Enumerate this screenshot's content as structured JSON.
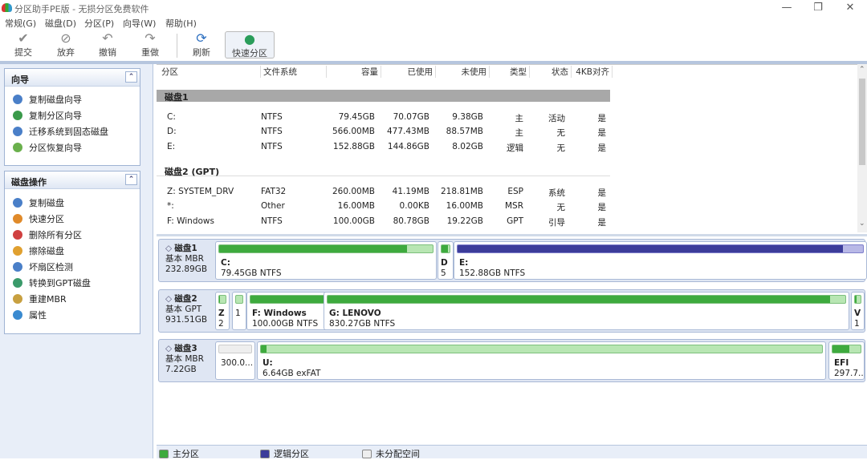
{
  "window": {
    "title": "分区助手PE版 - 无损分区免费软件"
  },
  "menu": [
    "常规(G)",
    "磁盘(D)",
    "分区(P)",
    "向导(W)",
    "帮助(H)"
  ],
  "toolbar": [
    {
      "label": "提交",
      "icon": "check-icon"
    },
    {
      "label": "放弃",
      "icon": "discard-icon"
    },
    {
      "label": "撤销",
      "icon": "undo-icon"
    },
    {
      "label": "重做",
      "icon": "redo-icon"
    },
    {
      "label": "刷新",
      "icon": "refresh-icon"
    },
    {
      "label": "快速分区",
      "icon": "quick-partition-icon"
    }
  ],
  "wizard": {
    "title": "向导",
    "items": [
      "复制磁盘向导",
      "复制分区向导",
      "迁移系统到固态磁盘",
      "分区恢复向导"
    ]
  },
  "ops": {
    "title": "磁盘操作",
    "items": [
      "复制磁盘",
      "快速分区",
      "删除所有分区",
      "擦除磁盘",
      "坏扇区检测",
      "转换到GPT磁盘",
      "重建MBR",
      "属性"
    ]
  },
  "table": {
    "headers": [
      "分区",
      "文件系统",
      "容量",
      "已使用",
      "未使用",
      "类型",
      "状态",
      "4KB对齐"
    ],
    "disks": [
      {
        "name": "磁盘1",
        "rows": [
          [
            "C:",
            "NTFS",
            "79.45GB",
            "70.07GB",
            "9.38GB",
            "主",
            "活动",
            "是"
          ],
          [
            "D:",
            "NTFS",
            "566.00MB",
            "477.43MB",
            "88.57MB",
            "主",
            "无",
            "是"
          ],
          [
            "E:",
            "NTFS",
            "152.88GB",
            "144.86GB",
            "8.02GB",
            "逻辑",
            "无",
            "是"
          ]
        ]
      },
      {
        "name": "磁盘2 (GPT)",
        "rows": [
          [
            "Z: SYSTEM_DRV",
            "FAT32",
            "260.00MB",
            "41.19MB",
            "218.81MB",
            "ESP",
            "系统",
            "是"
          ],
          [
            "*:",
            "Other",
            "16.00MB",
            "0.00KB",
            "16.00MB",
            "MSR",
            "无",
            "是"
          ],
          [
            "F: Windows",
            "NTFS",
            "100.00GB",
            "80.78GB",
            "19.22GB",
            "GPT",
            "引导",
            "是"
          ]
        ]
      }
    ]
  },
  "map": [
    {
      "name": "磁盘1",
      "type": "基本 MBR",
      "size": "232.89GB",
      "parts": [
        {
          "l1": "C:",
          "l2": "79.45GB NTFS",
          "kind": "primary",
          "used": 0.88
        },
        {
          "l1": "D",
          "l2": "5",
          "kind": "primary",
          "used": 0.84
        },
        {
          "l1": "E:",
          "l2": "152.88GB NTFS",
          "kind": "logical",
          "used": 0.95
        }
      ]
    },
    {
      "name": "磁盘2",
      "type": "基本 GPT",
      "size": "931.51GB",
      "parts": [
        {
          "l1": "Z",
          "l2": "2",
          "kind": "primary",
          "used": 0.16
        },
        {
          "l1": "",
          "l2": "1",
          "kind": "primary",
          "used": 0
        },
        {
          "l1": "F: Windows",
          "l2": "100.00GB NTFS",
          "kind": "primary",
          "used": 0.81
        },
        {
          "l1": "G: LENOVO",
          "l2": "830.27GB NTFS",
          "kind": "primary",
          "used": 0.97
        },
        {
          "l1": "V",
          "l2": "1",
          "kind": "primary",
          "used": 0.3
        }
      ]
    },
    {
      "name": "磁盘3",
      "type": "基本 MBR",
      "size": "7.22GB",
      "parts": [
        {
          "l1": "",
          "l2": "300.0...",
          "kind": "unallocated",
          "used": 0
        },
        {
          "l1": "U:",
          "l2": "6.64GB exFAT",
          "kind": "primary",
          "used": 0.01
        },
        {
          "l1": "EFI",
          "l2": "297.7...",
          "kind": "primary",
          "used": 0.6
        }
      ]
    }
  ],
  "legend": [
    "主分区",
    "逻辑分区",
    "未分配空间"
  ],
  "colors": {
    "primary": "#3eaa3e",
    "logical": "#3c3c9a",
    "unallocated": "#eeeeee",
    "accent": "#b6c6de"
  }
}
